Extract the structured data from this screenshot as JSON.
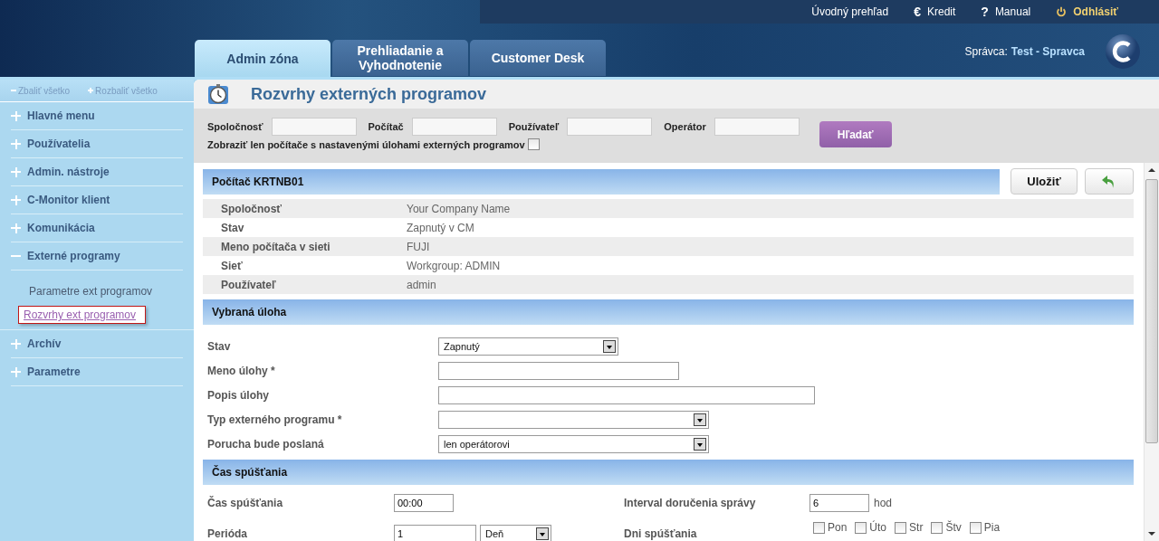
{
  "top_links": [
    {
      "label": "Úvodný prehľad",
      "kind": "plain"
    },
    {
      "label": "Kredit",
      "kind": "glyph",
      "glyph": "€"
    },
    {
      "label": "Manual",
      "kind": "glyph",
      "glyph": "?"
    },
    {
      "label": "Odhlásiť",
      "kind": "logout"
    }
  ],
  "tabs": [
    {
      "label": "Admin zóna",
      "selected": true
    },
    {
      "label": "Prehliadanie a Vyhodnotenie",
      "selected": false
    },
    {
      "label": "Customer Desk",
      "selected": false
    }
  ],
  "user": {
    "prefix": "Správca:",
    "name": "Test - Spravca"
  },
  "sidebar": {
    "collapse_all": "Zbaliť všetko",
    "expand_all": "Rozbaliť všetko",
    "items": [
      {
        "label": "Hlavné menu",
        "expanded": false
      },
      {
        "label": "Používatelia",
        "expanded": false
      },
      {
        "label": "Admin. nástroje",
        "expanded": false
      },
      {
        "label": "C-Monitor klient",
        "expanded": false
      },
      {
        "label": "Komunikácia",
        "expanded": false
      },
      {
        "label": "Externé programy",
        "expanded": true,
        "children": [
          {
            "label": "Parametre ext programov",
            "selected": false
          },
          {
            "label": "Rozvrhy ext programov",
            "selected": true
          }
        ]
      },
      {
        "label": "Archív",
        "expanded": false
      },
      {
        "label": "Parametre",
        "expanded": false
      }
    ]
  },
  "page_title": "Rozvrhy externých programov",
  "filter": {
    "fields": [
      {
        "label": "Spoločnosť"
      },
      {
        "label": "Počítač"
      },
      {
        "label": "Používateľ"
      },
      {
        "label": "Operátor"
      }
    ],
    "only_with_tasks": {
      "label": "Zobraziť len počítače s nastavenými úlohami externých programov",
      "checked": false
    },
    "search_button": "Hľadať"
  },
  "computer": {
    "title": "Počítač KRTNB01",
    "save_button": "Uložiť",
    "rows": [
      {
        "label": "Spoločnosť",
        "value": "Your Company Name"
      },
      {
        "label": "Stav",
        "value": "Zapnutý v CM"
      },
      {
        "label": "Meno počítača v sieti",
        "value": "FUJI"
      },
      {
        "label": "Sieť",
        "value": "Workgroup: ADMIN"
      },
      {
        "label": "Používateľ",
        "value": "admin"
      }
    ]
  },
  "task": {
    "title": "Vybraná úloha",
    "fields": [
      {
        "label": "Stav",
        "kind": "select",
        "value": "Zapnutý"
      },
      {
        "label": "Meno úlohy *",
        "kind": "input"
      },
      {
        "label": "Popis úlohy",
        "kind": "input"
      },
      {
        "label": "Typ externého programu *",
        "kind": "select"
      },
      {
        "label": "Porucha bude poslaná",
        "kind": "select",
        "value": "len operátorovi"
      }
    ]
  },
  "schedule": {
    "title": "Čas spúšťania",
    "start_time": {
      "label": "Čas spúšťania",
      "value": "00:00"
    },
    "interval": {
      "label": "Interval doručenia správy",
      "value": "6",
      "unit": "hod"
    },
    "period": {
      "label": "Perióda",
      "value": "1",
      "unit_value": "Deň"
    },
    "days": {
      "label": "Dni spúšťania",
      "items": [
        {
          "label": "Pon",
          "checked": false
        },
        {
          "label": "Úto",
          "checked": false
        },
        {
          "label": "Str",
          "checked": false
        },
        {
          "label": "Štv",
          "checked": false
        },
        {
          "label": "Pia",
          "checked": false
        }
      ]
    }
  }
}
